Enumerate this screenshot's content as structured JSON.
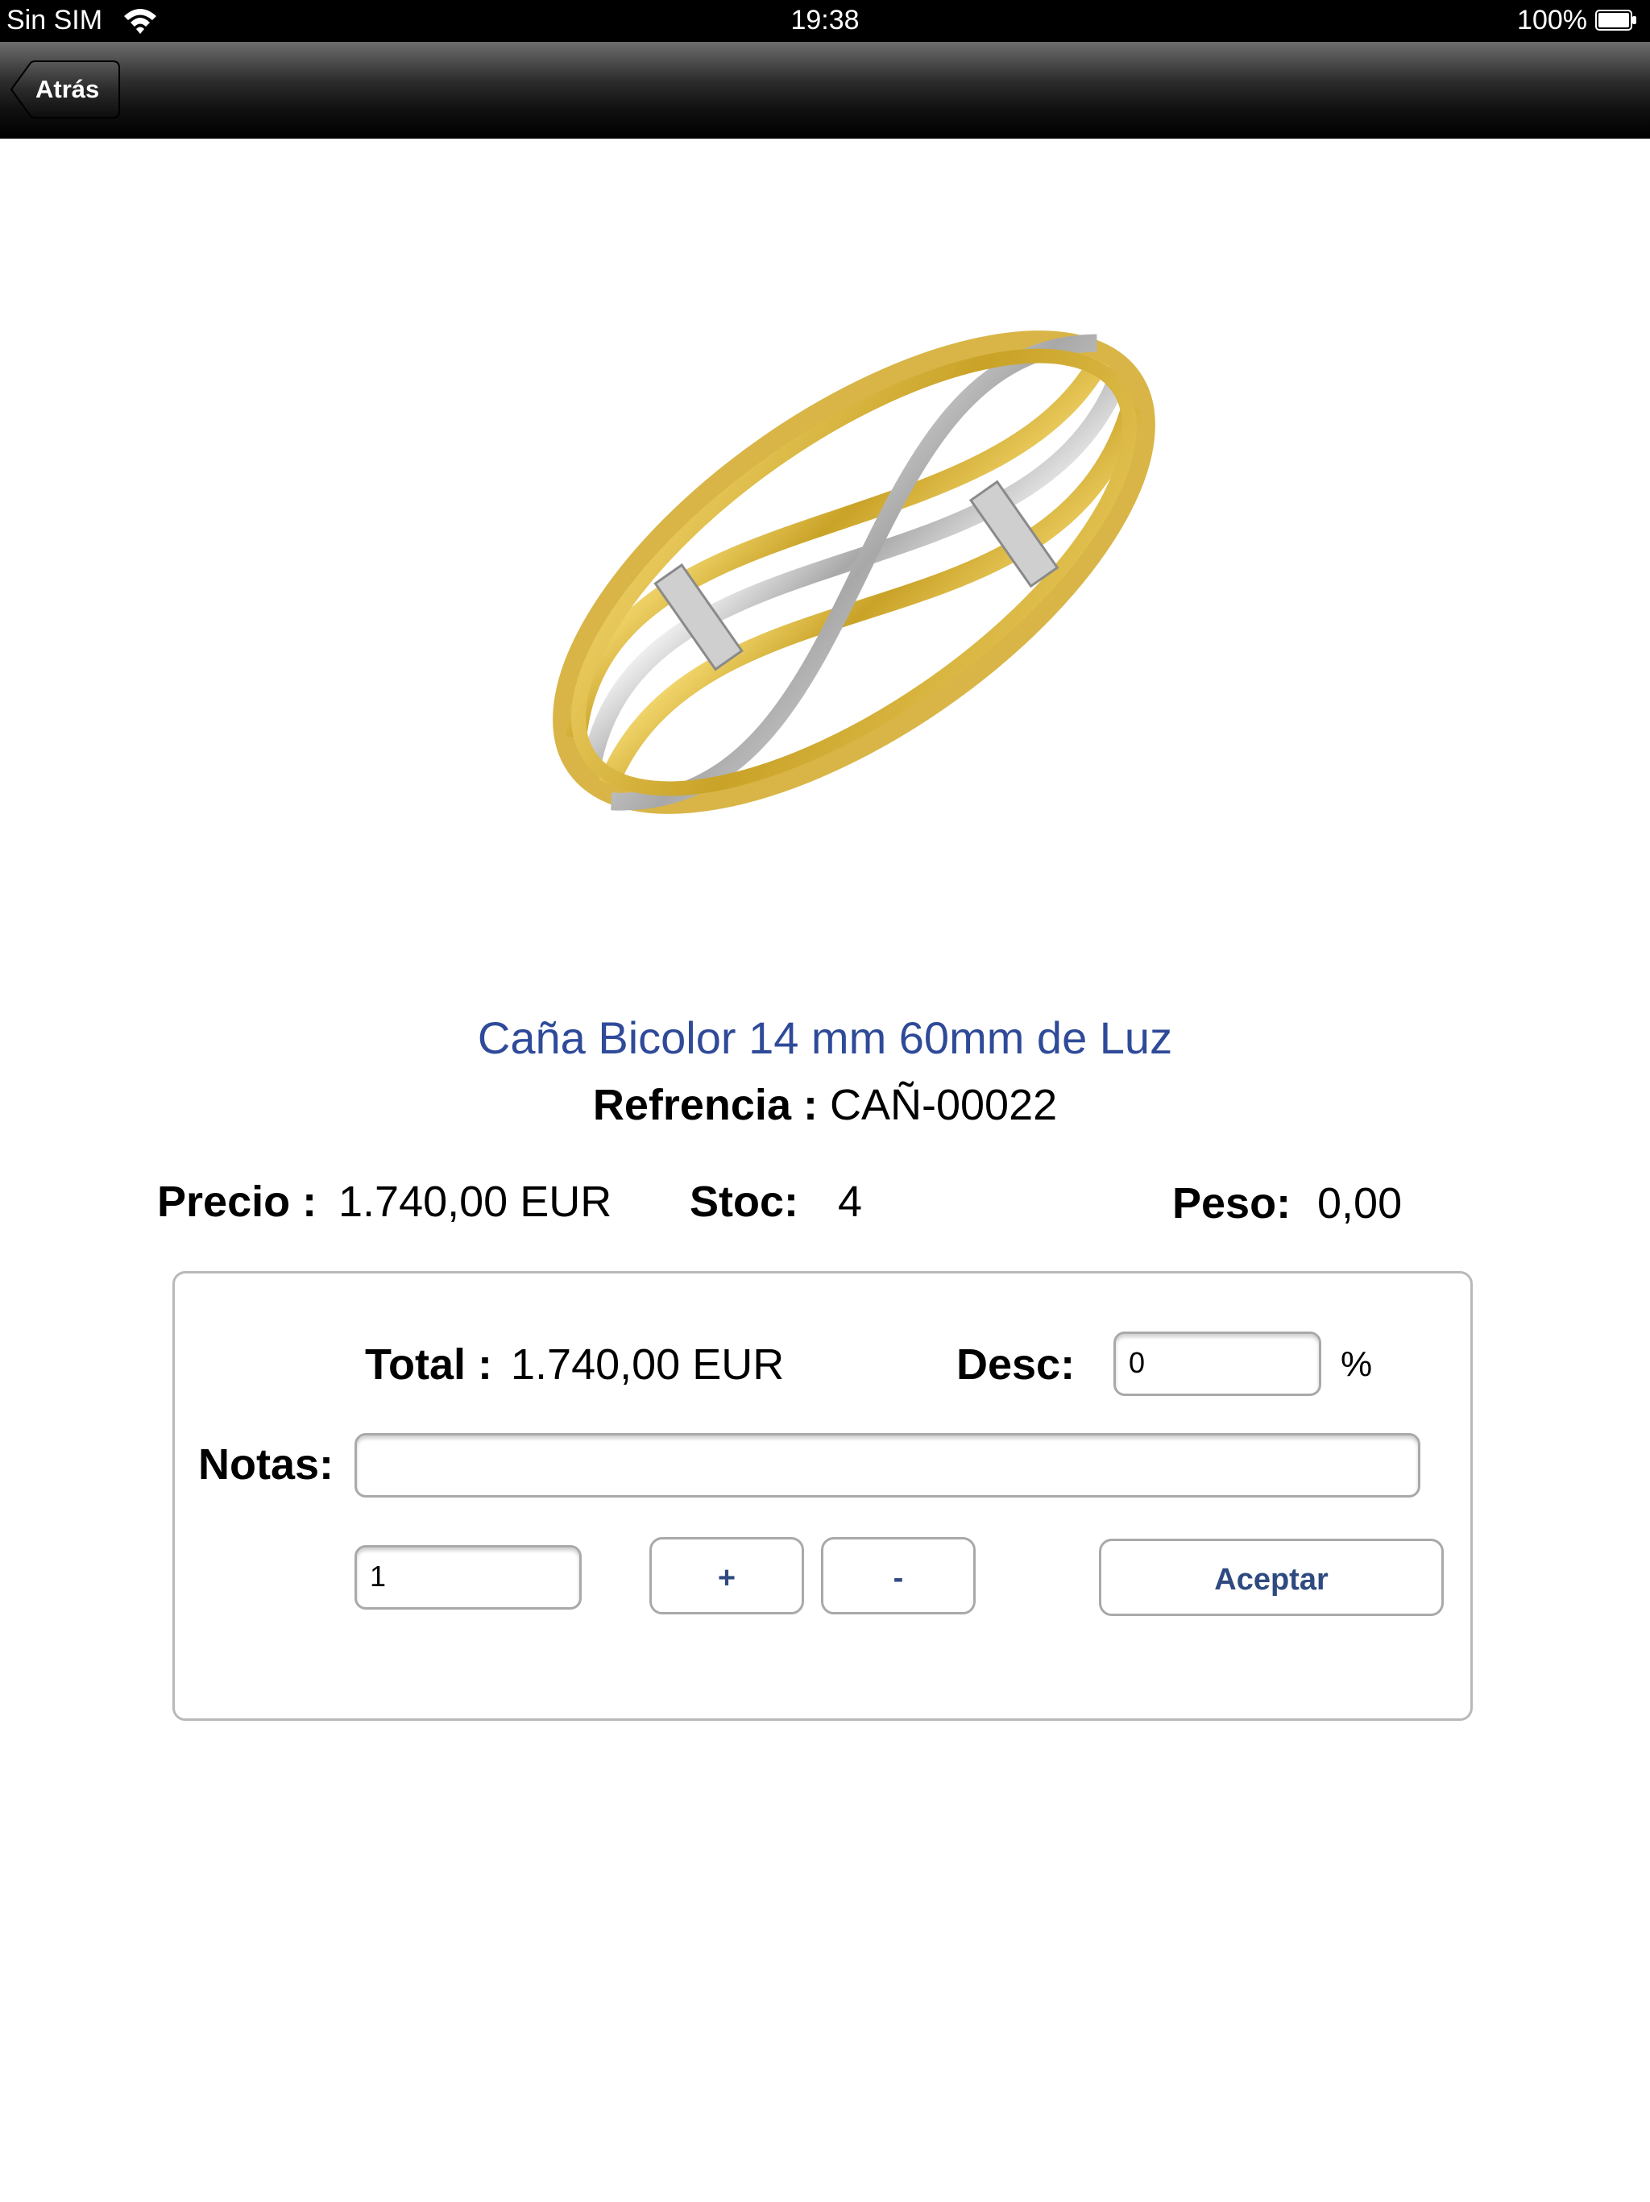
{
  "status_bar": {
    "carrier": "Sin SIM",
    "time": "19:38",
    "battery": "100%"
  },
  "nav": {
    "back_label": "Atrás"
  },
  "product": {
    "image_icon": "two-tone-gold-ring-image",
    "title": "Caña Bicolor 14 mm 60mm de Luz",
    "reference_label": "Refrencia :",
    "reference_value": "CAÑ-00022",
    "price_label": "Precio :",
    "price_value": "1.740,00 EUR",
    "stock_label": "Stoc:",
    "stock_value": "4",
    "weight_label": "Peso:",
    "weight_value": "0,00"
  },
  "order": {
    "total_label": "Total :",
    "total_value": "1.740,00 EUR",
    "discount_label": "Desc:",
    "discount_value": "0",
    "percent_symbol": "%",
    "notes_label": "Notas:",
    "notes_value": "",
    "quantity_value": "1",
    "plus_label": "+",
    "minus_label": "-",
    "accept_label": "Aceptar"
  },
  "colors": {
    "title": "#2f4a99",
    "button_text": "#2f4a80",
    "gold": "#d9b43a",
    "silver": "#c9c9c9"
  }
}
